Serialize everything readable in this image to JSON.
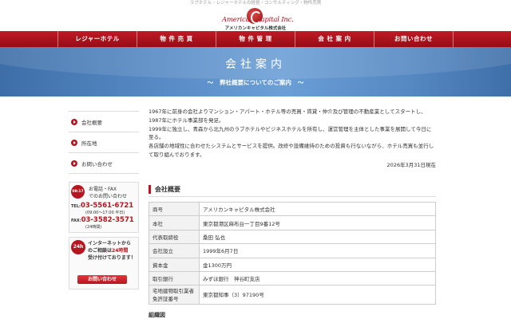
{
  "header": {
    "tagline": "ラブホテル・レジャーホテルの経営・コンサルティング・物件売買",
    "logo_script": "American Capital Inc.",
    "logo_jp": "アメリカンキャピタル株式会社"
  },
  "nav": {
    "items": [
      "レジャーホテル",
      "物 件 売 買",
      "物 件 管 理",
      "会 社 案 内",
      "お問い合わせ"
    ]
  },
  "hero": {
    "title": "会社案内",
    "subtitle": "弊社概要についてのご案内",
    "tilde": "〜"
  },
  "sidebar": {
    "items": [
      "会社概要",
      "所在地",
      "お問い合わせ"
    ],
    "contact": {
      "badge": "09:17",
      "heading_line1": "お電話・FAX",
      "heading_line2": "でのお問い合わせ",
      "tel_label": "TEL:",
      "tel_number": "03-5561-6721",
      "tel_hours": "(09:00〜17:00 平日)",
      "fax_label": "FAX:",
      "fax_number": "03-3582-3571",
      "fax_hours": "(24時間)"
    },
    "net": {
      "badge": "24h",
      "line1": "インターネットから",
      "line2_pre": "のご相談は",
      "line2_red": "24時間",
      "line3": "受け付けております！",
      "button": "お問い合わせ"
    }
  },
  "main": {
    "intro_lines": [
      "1967年に前身の会社よりマンション・アパート・ホテル等の売買・賃貸・仲介及び管理の不動産業としてスタートし、",
      "1987年にホテル事業部を発足。",
      "1999年に独立し、青森から北九州のラブホテルやビジネスホテルを所有し、運営管理を主体とした事業を展開して今日に",
      "至る。",
      "各店舗の地域性に合わせたシステムとサービスを提供。改修や設備維持のための投資も行ないながら、ホテル売買も並行し",
      "て取り組んでおります。"
    ],
    "date": "2026年3月31日現在",
    "section_title": "会社概要",
    "table": [
      {
        "label": "商号",
        "value": "アメリカンキャピタル株式会社"
      },
      {
        "label": "本社",
        "value": "東京都港区麻布台一丁目9番12号"
      },
      {
        "label": "代表取締役",
        "value": "桑田 弘也"
      },
      {
        "label": "会社設立",
        "value": "1999年6月7日"
      },
      {
        "label": "資本金",
        "value": "金1300万円"
      },
      {
        "label": "取引銀行",
        "value": "みずほ銀行　神谷町支店"
      },
      {
        "label_line1": "宅地建物取引業者",
        "label_line2": "免許証番号",
        "value": "東京都知事（3）97190号"
      }
    ],
    "org_title": "組織図"
  }
}
